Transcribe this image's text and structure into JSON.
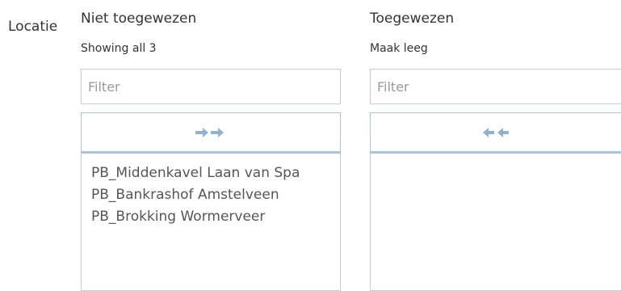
{
  "field_label": "Locatie",
  "unassigned": {
    "title": "Niet toegewezen",
    "subtitle": "Showing all 3",
    "filter_placeholder": "Filter",
    "move_button": "move-all-right",
    "items": [
      "PB_Middenkavel Laan van Spa",
      "PB_Bankrashof Amstelveen",
      "PB_Brokking Wormerveer"
    ]
  },
  "assigned": {
    "title": "Toegewezen",
    "subtitle": "Maak leeg",
    "filter_placeholder": "Filter",
    "move_button": "move-all-left",
    "items": []
  },
  "colors": {
    "arrow": "#8fb3cf",
    "button_border": "#a9c4d8",
    "input_border": "#cccccc",
    "text": "#333333"
  }
}
